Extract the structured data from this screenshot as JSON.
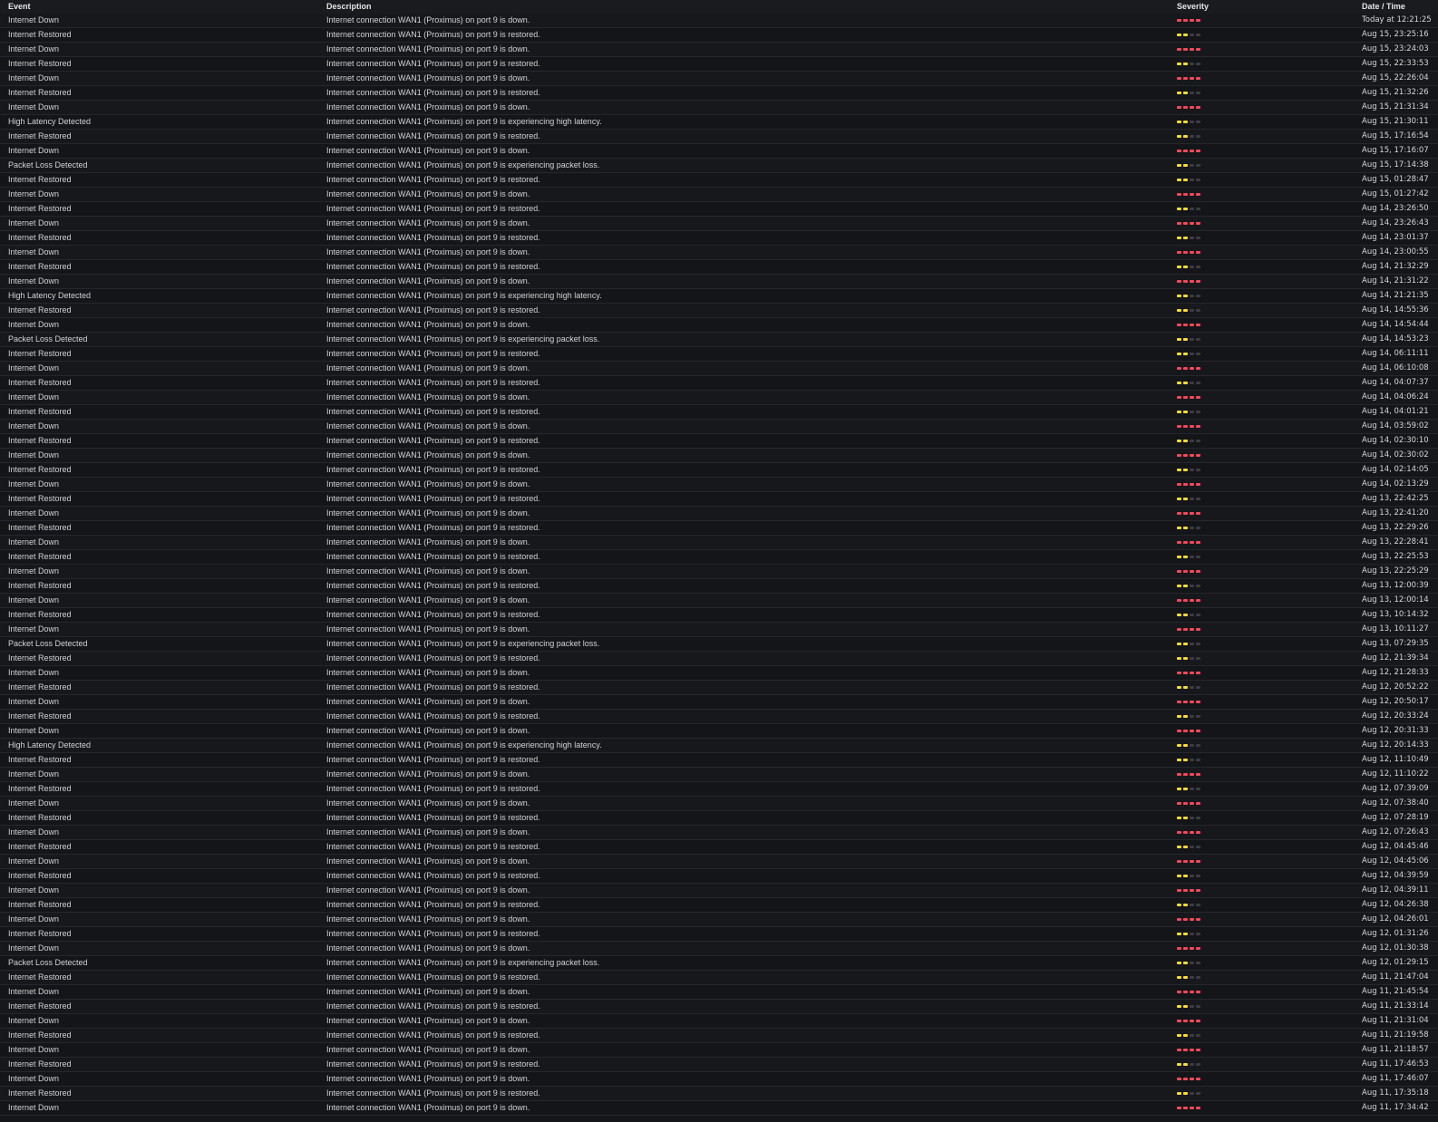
{
  "colors": {
    "critical": "#f2495c",
    "warning": "#fade2a",
    "inactive": "#3a3c40"
  },
  "columns": {
    "event": "Event",
    "description": "Description",
    "severity": "Severity",
    "datetime": "Date / Time"
  },
  "rows": [
    {
      "event": "Internet Down",
      "description": "Internet connection WAN1 (Proximus) on port 9 is down.",
      "severity": 4,
      "datetime": "Today at 12:21:25"
    },
    {
      "event": "Internet Restored",
      "description": "Internet connection WAN1 (Proximus) on port 9 is restored.",
      "severity": 2,
      "datetime": "Aug 15, 23:25:16"
    },
    {
      "event": "Internet Down",
      "description": "Internet connection WAN1 (Proximus) on port 9 is down.",
      "severity": 4,
      "datetime": "Aug 15, 23:24:03"
    },
    {
      "event": "Internet Restored",
      "description": "Internet connection WAN1 (Proximus) on port 9 is restored.",
      "severity": 2,
      "datetime": "Aug 15, 22:33:53"
    },
    {
      "event": "Internet Down",
      "description": "Internet connection WAN1 (Proximus) on port 9 is down.",
      "severity": 4,
      "datetime": "Aug 15, 22:26:04"
    },
    {
      "event": "Internet Restored",
      "description": "Internet connection WAN1 (Proximus) on port 9 is restored.",
      "severity": 2,
      "datetime": "Aug 15, 21:32:26"
    },
    {
      "event": "Internet Down",
      "description": "Internet connection WAN1 (Proximus) on port 9 is down.",
      "severity": 4,
      "datetime": "Aug 15, 21:31:34"
    },
    {
      "event": "High Latency Detected",
      "description": "Internet connection WAN1 (Proximus) on port 9 is experiencing high latency.",
      "severity": 2,
      "datetime": "Aug 15, 21:30:11"
    },
    {
      "event": "Internet Restored",
      "description": "Internet connection WAN1 (Proximus) on port 9 is restored.",
      "severity": 2,
      "datetime": "Aug 15, 17:16:54"
    },
    {
      "event": "Internet Down",
      "description": "Internet connection WAN1 (Proximus) on port 9 is down.",
      "severity": 4,
      "datetime": "Aug 15, 17:16:07"
    },
    {
      "event": "Packet Loss Detected",
      "description": "Internet connection WAN1 (Proximus) on port 9 is experiencing packet loss.",
      "severity": 2,
      "datetime": "Aug 15, 17:14:38"
    },
    {
      "event": "Internet Restored",
      "description": "Internet connection WAN1 (Proximus) on port 9 is restored.",
      "severity": 2,
      "datetime": "Aug 15, 01:28:47"
    },
    {
      "event": "Internet Down",
      "description": "Internet connection WAN1 (Proximus) on port 9 is down.",
      "severity": 4,
      "datetime": "Aug 15, 01:27:42"
    },
    {
      "event": "Internet Restored",
      "description": "Internet connection WAN1 (Proximus) on port 9 is restored.",
      "severity": 2,
      "datetime": "Aug 14, 23:26:50"
    },
    {
      "event": "Internet Down",
      "description": "Internet connection WAN1 (Proximus) on port 9 is down.",
      "severity": 4,
      "datetime": "Aug 14, 23:26:43"
    },
    {
      "event": "Internet Restored",
      "description": "Internet connection WAN1 (Proximus) on port 9 is restored.",
      "severity": 2,
      "datetime": "Aug 14, 23:01:37"
    },
    {
      "event": "Internet Down",
      "description": "Internet connection WAN1 (Proximus) on port 9 is down.",
      "severity": 4,
      "datetime": "Aug 14, 23:00:55"
    },
    {
      "event": "Internet Restored",
      "description": "Internet connection WAN1 (Proximus) on port 9 is restored.",
      "severity": 2,
      "datetime": "Aug 14, 21:32:29"
    },
    {
      "event": "Internet Down",
      "description": "Internet connection WAN1 (Proximus) on port 9 is down.",
      "severity": 4,
      "datetime": "Aug 14, 21:31:22"
    },
    {
      "event": "High Latency Detected",
      "description": "Internet connection WAN1 (Proximus) on port 9 is experiencing high latency.",
      "severity": 2,
      "datetime": "Aug 14, 21:21:35"
    },
    {
      "event": "Internet Restored",
      "description": "Internet connection WAN1 (Proximus) on port 9 is restored.",
      "severity": 2,
      "datetime": "Aug 14, 14:55:36"
    },
    {
      "event": "Internet Down",
      "description": "Internet connection WAN1 (Proximus) on port 9 is down.",
      "severity": 4,
      "datetime": "Aug 14, 14:54:44"
    },
    {
      "event": "Packet Loss Detected",
      "description": "Internet connection WAN1 (Proximus) on port 9 is experiencing packet loss.",
      "severity": 2,
      "datetime": "Aug 14, 14:53:23"
    },
    {
      "event": "Internet Restored",
      "description": "Internet connection WAN1 (Proximus) on port 9 is restored.",
      "severity": 2,
      "datetime": "Aug 14, 06:11:11"
    },
    {
      "event": "Internet Down",
      "description": "Internet connection WAN1 (Proximus) on port 9 is down.",
      "severity": 4,
      "datetime": "Aug 14, 06:10:08"
    },
    {
      "event": "Internet Restored",
      "description": "Internet connection WAN1 (Proximus) on port 9 is restored.",
      "severity": 2,
      "datetime": "Aug 14, 04:07:37"
    },
    {
      "event": "Internet Down",
      "description": "Internet connection WAN1 (Proximus) on port 9 is down.",
      "severity": 4,
      "datetime": "Aug 14, 04:06:24"
    },
    {
      "event": "Internet Restored",
      "description": "Internet connection WAN1 (Proximus) on port 9 is restored.",
      "severity": 2,
      "datetime": "Aug 14, 04:01:21"
    },
    {
      "event": "Internet Down",
      "description": "Internet connection WAN1 (Proximus) on port 9 is down.",
      "severity": 4,
      "datetime": "Aug 14, 03:59:02"
    },
    {
      "event": "Internet Restored",
      "description": "Internet connection WAN1 (Proximus) on port 9 is restored.",
      "severity": 2,
      "datetime": "Aug 14, 02:30:10"
    },
    {
      "event": "Internet Down",
      "description": "Internet connection WAN1 (Proximus) on port 9 is down.",
      "severity": 4,
      "datetime": "Aug 14, 02:30:02"
    },
    {
      "event": "Internet Restored",
      "description": "Internet connection WAN1 (Proximus) on port 9 is restored.",
      "severity": 2,
      "datetime": "Aug 14, 02:14:05"
    },
    {
      "event": "Internet Down",
      "description": "Internet connection WAN1 (Proximus) on port 9 is down.",
      "severity": 4,
      "datetime": "Aug 14, 02:13:29"
    },
    {
      "event": "Internet Restored",
      "description": "Internet connection WAN1 (Proximus) on port 9 is restored.",
      "severity": 2,
      "datetime": "Aug 13, 22:42:25"
    },
    {
      "event": "Internet Down",
      "description": "Internet connection WAN1 (Proximus) on port 9 is down.",
      "severity": 4,
      "datetime": "Aug 13, 22:41:20"
    },
    {
      "event": "Internet Restored",
      "description": "Internet connection WAN1 (Proximus) on port 9 is restored.",
      "severity": 2,
      "datetime": "Aug 13, 22:29:26"
    },
    {
      "event": "Internet Down",
      "description": "Internet connection WAN1 (Proximus) on port 9 is down.",
      "severity": 4,
      "datetime": "Aug 13, 22:28:41"
    },
    {
      "event": "Internet Restored",
      "description": "Internet connection WAN1 (Proximus) on port 9 is restored.",
      "severity": 2,
      "datetime": "Aug 13, 22:25:53"
    },
    {
      "event": "Internet Down",
      "description": "Internet connection WAN1 (Proximus) on port 9 is down.",
      "severity": 4,
      "datetime": "Aug 13, 22:25:29"
    },
    {
      "event": "Internet Restored",
      "description": "Internet connection WAN1 (Proximus) on port 9 is restored.",
      "severity": 2,
      "datetime": "Aug 13, 12:00:39"
    },
    {
      "event": "Internet Down",
      "description": "Internet connection WAN1 (Proximus) on port 9 is down.",
      "severity": 4,
      "datetime": "Aug 13, 12:00:14"
    },
    {
      "event": "Internet Restored",
      "description": "Internet connection WAN1 (Proximus) on port 9 is restored.",
      "severity": 2,
      "datetime": "Aug 13, 10:14:32"
    },
    {
      "event": "Internet Down",
      "description": "Internet connection WAN1 (Proximus) on port 9 is down.",
      "severity": 4,
      "datetime": "Aug 13, 10:11:27"
    },
    {
      "event": "Packet Loss Detected",
      "description": "Internet connection WAN1 (Proximus) on port 9 is experiencing packet loss.",
      "severity": 2,
      "datetime": "Aug 13, 07:29:35"
    },
    {
      "event": "Internet Restored",
      "description": "Internet connection WAN1 (Proximus) on port 9 is restored.",
      "severity": 2,
      "datetime": "Aug 12, 21:39:34"
    },
    {
      "event": "Internet Down",
      "description": "Internet connection WAN1 (Proximus) on port 9 is down.",
      "severity": 4,
      "datetime": "Aug 12, 21:28:33"
    },
    {
      "event": "Internet Restored",
      "description": "Internet connection WAN1 (Proximus) on port 9 is restored.",
      "severity": 2,
      "datetime": "Aug 12, 20:52:22"
    },
    {
      "event": "Internet Down",
      "description": "Internet connection WAN1 (Proximus) on port 9 is down.",
      "severity": 4,
      "datetime": "Aug 12, 20:50:17"
    },
    {
      "event": "Internet Restored",
      "description": "Internet connection WAN1 (Proximus) on port 9 is restored.",
      "severity": 2,
      "datetime": "Aug 12, 20:33:24"
    },
    {
      "event": "Internet Down",
      "description": "Internet connection WAN1 (Proximus) on port 9 is down.",
      "severity": 4,
      "datetime": "Aug 12, 20:31:33"
    },
    {
      "event": "High Latency Detected",
      "description": "Internet connection WAN1 (Proximus) on port 9 is experiencing high latency.",
      "severity": 2,
      "datetime": "Aug 12, 20:14:33"
    },
    {
      "event": "Internet Restored",
      "description": "Internet connection WAN1 (Proximus) on port 9 is restored.",
      "severity": 2,
      "datetime": "Aug 12, 11:10:49"
    },
    {
      "event": "Internet Down",
      "description": "Internet connection WAN1 (Proximus) on port 9 is down.",
      "severity": 4,
      "datetime": "Aug 12, 11:10:22"
    },
    {
      "event": "Internet Restored",
      "description": "Internet connection WAN1 (Proximus) on port 9 is restored.",
      "severity": 2,
      "datetime": "Aug 12, 07:39:09"
    },
    {
      "event": "Internet Down",
      "description": "Internet connection WAN1 (Proximus) on port 9 is down.",
      "severity": 4,
      "datetime": "Aug 12, 07:38:40"
    },
    {
      "event": "Internet Restored",
      "description": "Internet connection WAN1 (Proximus) on port 9 is restored.",
      "severity": 2,
      "datetime": "Aug 12, 07:28:19"
    },
    {
      "event": "Internet Down",
      "description": "Internet connection WAN1 (Proximus) on port 9 is down.",
      "severity": 4,
      "datetime": "Aug 12, 07:26:43"
    },
    {
      "event": "Internet Restored",
      "description": "Internet connection WAN1 (Proximus) on port 9 is restored.",
      "severity": 2,
      "datetime": "Aug 12, 04:45:46"
    },
    {
      "event": "Internet Down",
      "description": "Internet connection WAN1 (Proximus) on port 9 is down.",
      "severity": 4,
      "datetime": "Aug 12, 04:45:06"
    },
    {
      "event": "Internet Restored",
      "description": "Internet connection WAN1 (Proximus) on port 9 is restored.",
      "severity": 2,
      "datetime": "Aug 12, 04:39:59"
    },
    {
      "event": "Internet Down",
      "description": "Internet connection WAN1 (Proximus) on port 9 is down.",
      "severity": 4,
      "datetime": "Aug 12, 04:39:11"
    },
    {
      "event": "Internet Restored",
      "description": "Internet connection WAN1 (Proximus) on port 9 is restored.",
      "severity": 2,
      "datetime": "Aug 12, 04:26:38"
    },
    {
      "event": "Internet Down",
      "description": "Internet connection WAN1 (Proximus) on port 9 is down.",
      "severity": 4,
      "datetime": "Aug 12, 04:26:01"
    },
    {
      "event": "Internet Restored",
      "description": "Internet connection WAN1 (Proximus) on port 9 is restored.",
      "severity": 2,
      "datetime": "Aug 12, 01:31:26"
    },
    {
      "event": "Internet Down",
      "description": "Internet connection WAN1 (Proximus) on port 9 is down.",
      "severity": 4,
      "datetime": "Aug 12, 01:30:38"
    },
    {
      "event": "Packet Loss Detected",
      "description": "Internet connection WAN1 (Proximus) on port 9 is experiencing packet loss.",
      "severity": 2,
      "datetime": "Aug 12, 01:29:15"
    },
    {
      "event": "Internet Restored",
      "description": "Internet connection WAN1 (Proximus) on port 9 is restored.",
      "severity": 2,
      "datetime": "Aug 11, 21:47:04"
    },
    {
      "event": "Internet Down",
      "description": "Internet connection WAN1 (Proximus) on port 9 is down.",
      "severity": 4,
      "datetime": "Aug 11, 21:45:54"
    },
    {
      "event": "Internet Restored",
      "description": "Internet connection WAN1 (Proximus) on port 9 is restored.",
      "severity": 2,
      "datetime": "Aug 11, 21:33:14"
    },
    {
      "event": "Internet Down",
      "description": "Internet connection WAN1 (Proximus) on port 9 is down.",
      "severity": 4,
      "datetime": "Aug 11, 21:31:04"
    },
    {
      "event": "Internet Restored",
      "description": "Internet connection WAN1 (Proximus) on port 9 is restored.",
      "severity": 2,
      "datetime": "Aug 11, 21:19:58"
    },
    {
      "event": "Internet Down",
      "description": "Internet connection WAN1 (Proximus) on port 9 is down.",
      "severity": 4,
      "datetime": "Aug 11, 21:18:57"
    },
    {
      "event": "Internet Restored",
      "description": "Internet connection WAN1 (Proximus) on port 9 is restored.",
      "severity": 2,
      "datetime": "Aug 11, 17:46:53"
    },
    {
      "event": "Internet Down",
      "description": "Internet connection WAN1 (Proximus) on port 9 is down.",
      "severity": 4,
      "datetime": "Aug 11, 17:46:07"
    },
    {
      "event": "Internet Restored",
      "description": "Internet connection WAN1 (Proximus) on port 9 is restored.",
      "severity": 2,
      "datetime": "Aug 11, 17:35:18"
    },
    {
      "event": "Internet Down",
      "description": "Internet connection WAN1 (Proximus) on port 9 is down.",
      "severity": 4,
      "datetime": "Aug 11, 17:34:42"
    }
  ]
}
